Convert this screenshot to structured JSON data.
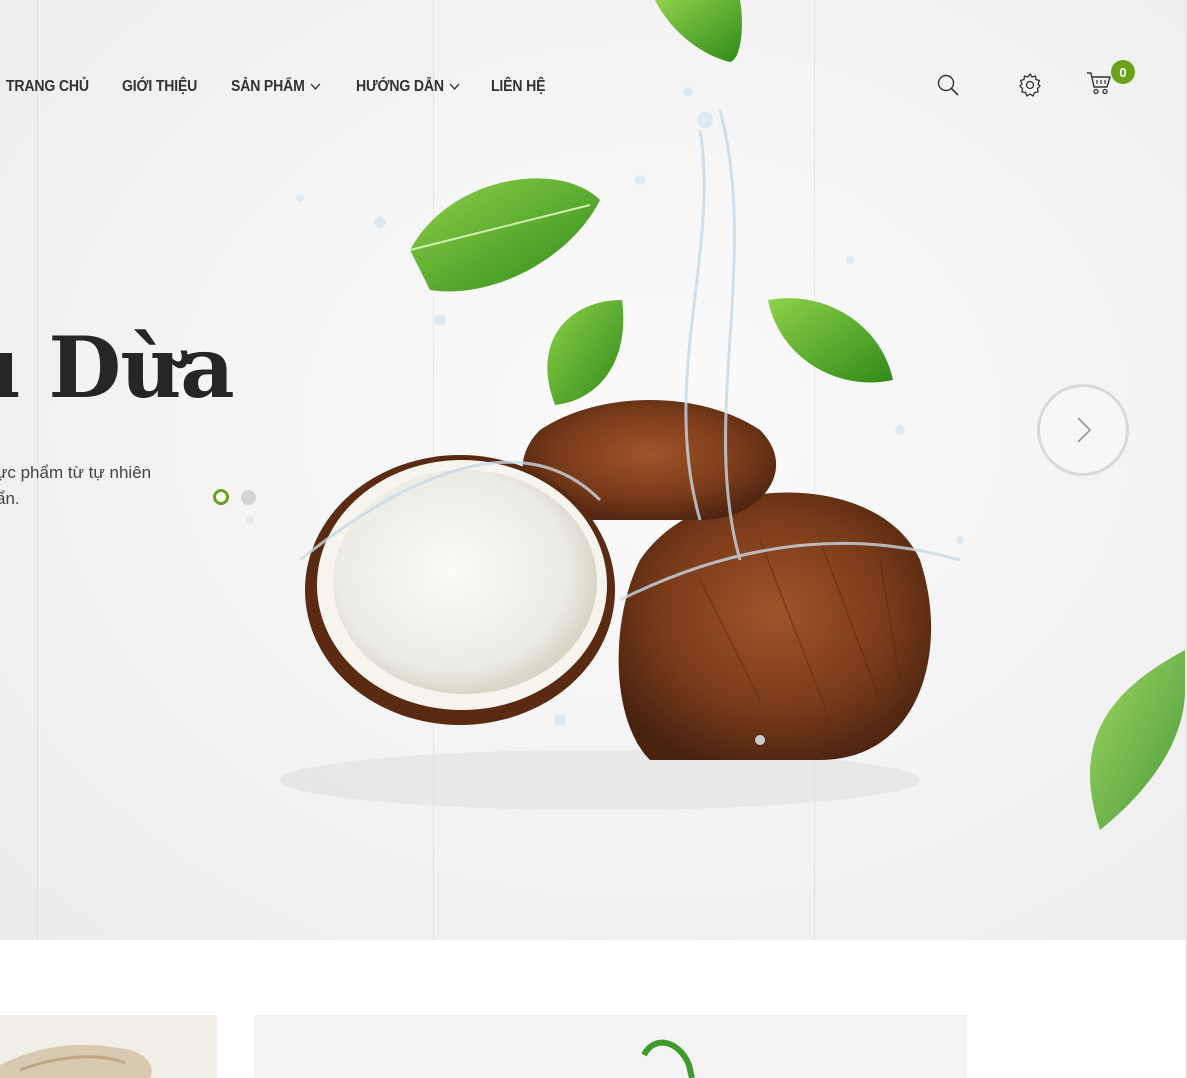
{
  "nav": {
    "items": [
      {
        "label": "TRANG CHỦ",
        "has_dropdown": false
      },
      {
        "label": "GIỚI THIỆU",
        "has_dropdown": false
      },
      {
        "label": "SẢN PHẨM",
        "has_dropdown": true
      },
      {
        "label": "HƯỚNG DẪN",
        "has_dropdown": true
      },
      {
        "label": "LIÊN HỆ",
        "has_dropdown": false
      }
    ]
  },
  "header": {
    "icons": [
      "search-icon",
      "gear-icon",
      "cart-icon"
    ],
    "cart_count": "0"
  },
  "hero": {
    "title": "u Dừa",
    "description": "ực phẩm từ tự nhiên\nẩn.",
    "slides_total": 2,
    "active_slide": 1
  },
  "colors": {
    "accent": "#69a31b",
    "text": "#333333",
    "title": "#262626"
  }
}
